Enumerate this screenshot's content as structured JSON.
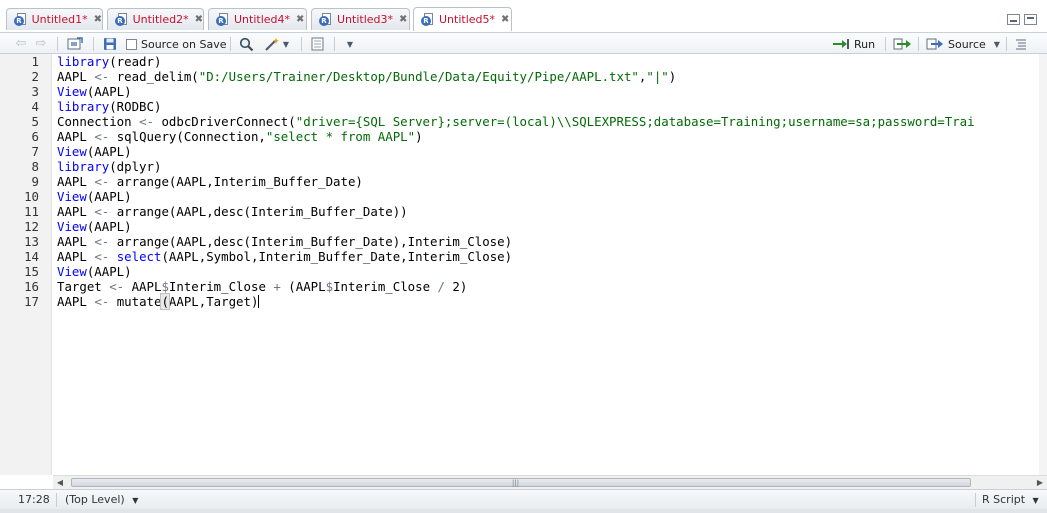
{
  "tabs": [
    {
      "label": "Untitled1*",
      "active": false
    },
    {
      "label": "Untitled2*",
      "active": false
    },
    {
      "label": "Untitled4*",
      "active": false
    },
    {
      "label": "Untitled3*",
      "active": false
    },
    {
      "label": "Untitled5*",
      "active": true
    }
  ],
  "toolbar": {
    "source_on_save_label": "Source on Save",
    "run_label": "Run",
    "source_label": "Source"
  },
  "editor": {
    "line_numbers": [
      "1",
      "2",
      "3",
      "4",
      "5",
      "6",
      "7",
      "8",
      "9",
      "10",
      "11",
      "12",
      "13",
      "14",
      "15",
      "16",
      "17"
    ],
    "lines": [
      "library(readr)",
      "AAPL <- read_delim(\"D:/Users/Trainer/Desktop/Bundle/Data/Equity/Pipe/AAPL.txt\",\"|\")",
      "View(AAPL)",
      "library(RODBC)",
      "Connection <- odbcDriverConnect(\"driver={SQL Server};server=(local)\\\\SQLEXPRESS;database=Training;username=sa;password=Trai",
      "AAPL <- sqlQuery(Connection,\"select * from AAPL\")",
      "View(AAPL)",
      "library(dplyr)",
      "AAPL <- arrange(AAPL,Interim_Buffer_Date)",
      "View(AAPL)",
      "AAPL <- arrange(AAPL,desc(Interim_Buffer_Date))",
      "View(AAPL)",
      "AAPL <- arrange(AAPL,desc(Interim_Buffer_Date),Interim_Close)",
      "AAPL <- select(AAPL,Symbol,Interim_Buffer_Date,Interim_Close)",
      "View(AAPL)",
      "Target <- AAPL$Interim_Close + (AAPL$Interim_Close / 2)",
      "AAPL <- mutate(AAPL,Target)"
    ]
  },
  "status": {
    "cursor_position": "17:28",
    "scope": "(Top Level)",
    "file_type": "R Script"
  },
  "colors": {
    "keyword": "#0000ff",
    "string": "#036a07",
    "operator": "#687687",
    "tab_label": "#c8102e"
  }
}
